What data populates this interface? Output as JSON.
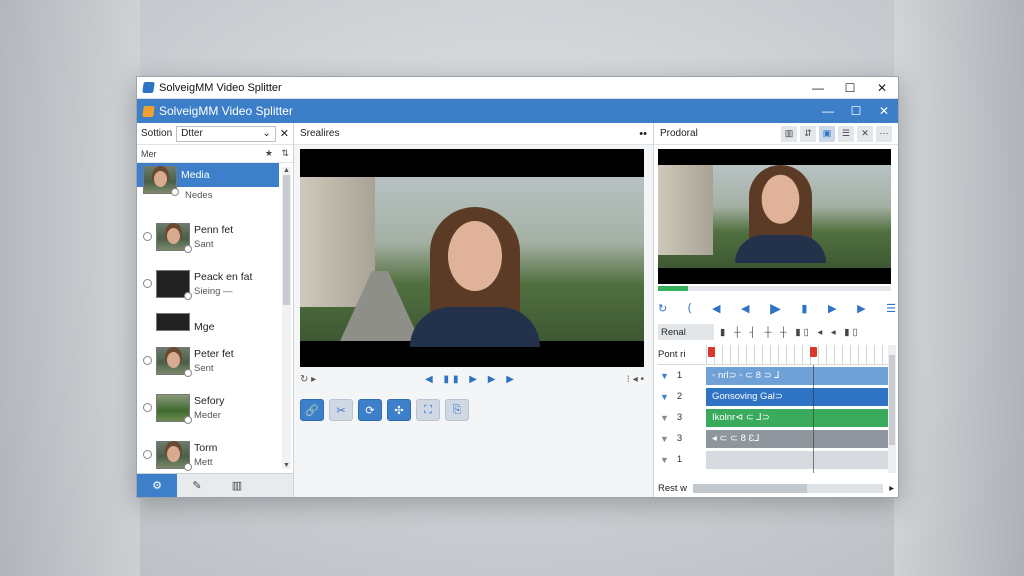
{
  "outer_window": {
    "title": "SolveigMM Video Splitter",
    "controls": [
      "—",
      "☐",
      "✕"
    ]
  },
  "inner_window": {
    "title": "SolveigMM Video Splitter",
    "controls": [
      "—",
      "☐",
      "✕"
    ]
  },
  "left_panel": {
    "header_label": "Sottion",
    "dropdown_value": "Dtter",
    "close": "✕",
    "sub_label": "Mer",
    "sub_icons": [
      "★",
      "⇅"
    ],
    "items": [
      {
        "title": "Media",
        "subtitle": "Nedes",
        "selected": true
      },
      {
        "title": "Penn fet",
        "subtitle": "Sant"
      },
      {
        "title": "Peack en fat",
        "subtitle": "Sieing —"
      },
      {
        "title": "Mge",
        "subtitle": ""
      },
      {
        "title": "Peter fet",
        "subtitle": "Sent"
      },
      {
        "title": "Sefory",
        "subtitle": "Meder"
      },
      {
        "title": "Torm",
        "subtitle": "Mett"
      }
    ],
    "footer_tabs": [
      "⚙",
      "✎",
      "▥"
    ]
  },
  "center_panel": {
    "header_label": "Srealires",
    "header_icon": "••",
    "controls_left": "↻ ▸",
    "controls_mid": "◀ ▮▮ ▶ ▶ ▶",
    "controls_right": "⁝   ◂ •",
    "tools": [
      "🔗",
      "✂",
      "⟳",
      "✣",
      "⛶",
      "⎘"
    ]
  },
  "right_panel": {
    "header_label": "Prodoral",
    "header_icons": [
      "▥",
      "⇵",
      "▣",
      "☰",
      "✕",
      "⋯"
    ],
    "transport": [
      "↻",
      "(",
      "◀",
      "◀",
      "▶",
      "▮",
      "▶",
      "▶",
      "☰"
    ],
    "timeline_label": "Renal",
    "timeline_icons": "▮ ┼ ┤ ┼ ┼ ▮▯ ◂ ◂ ▮▯",
    "ruler_label": "Pont ri",
    "tracks": [
      {
        "num": "1",
        "clip": "◦ nrl⊃ ◦ ⊂ 8 ⊃ ⅃",
        "style": "light"
      },
      {
        "num": "2",
        "clip": "Gonsoving Gal⊃",
        "style": "blue"
      },
      {
        "num": "3",
        "clip": "Ikolnr⊲ ⊂ ⅃⊃",
        "style": "green"
      },
      {
        "num": "3",
        "clip": "◂ ⊂ ⊂ 8 Ɛ⅃",
        "style": "gray"
      },
      {
        "num": "1",
        "clip": "",
        "style": "empty"
      }
    ],
    "footer_label": "Rest w",
    "footer_arrow": "▸"
  }
}
